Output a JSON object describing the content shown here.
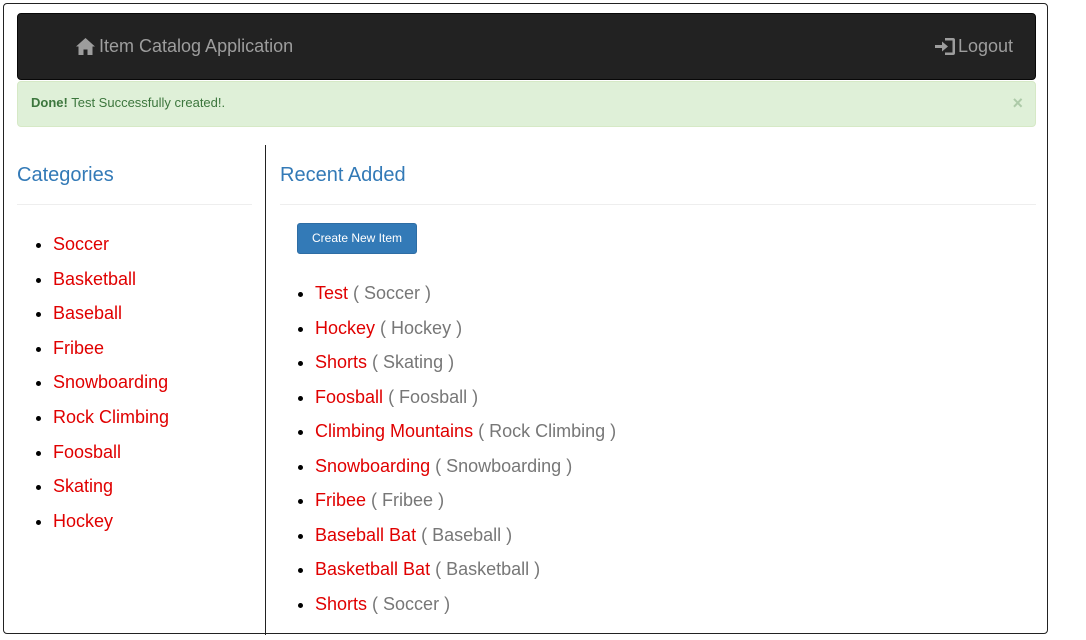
{
  "navbar": {
    "brand": "Item Catalog Application",
    "logout": "Logout"
  },
  "alert": {
    "strong": "Done!",
    "message": " Test Successfully created!.",
    "close": "×"
  },
  "sidebar": {
    "title": "Categories",
    "categories": [
      "Soccer",
      "Basketball",
      "Baseball",
      "Fribee",
      "Snowboarding",
      "Rock Climbing",
      "Foosball",
      "Skating",
      "Hockey"
    ]
  },
  "main": {
    "title": "Recent Added",
    "create_button": "Create New Item",
    "items": [
      {
        "name": "Test",
        "category": "( Soccer )"
      },
      {
        "name": "Hockey",
        "category": "( Hockey )"
      },
      {
        "name": "Shorts",
        "category": "( Skating )"
      },
      {
        "name": "Foosball",
        "category": "( Foosball )"
      },
      {
        "name": "Climbing Mountains",
        "category": "( Rock Climbing )"
      },
      {
        "name": "Snowboarding",
        "category": "( Snowboarding )"
      },
      {
        "name": "Fribee",
        "category": "( Fribee )"
      },
      {
        "name": "Baseball Bat",
        "category": "( Baseball )"
      },
      {
        "name": "Basketball Bat",
        "category": "( Basketball )"
      },
      {
        "name": "Shorts",
        "category": "( Soccer )"
      }
    ]
  },
  "icons": {
    "brand": "home-icon",
    "logout": "log-in-icon"
  },
  "colors": {
    "navbar_bg": "#222222",
    "nav_text": "#9d9d9d",
    "alert_bg": "#dff0d8",
    "alert_text": "#3c763d",
    "heading": "#337ab7",
    "link": "#e00000",
    "muted": "#777777",
    "primary": "#337ab7"
  }
}
